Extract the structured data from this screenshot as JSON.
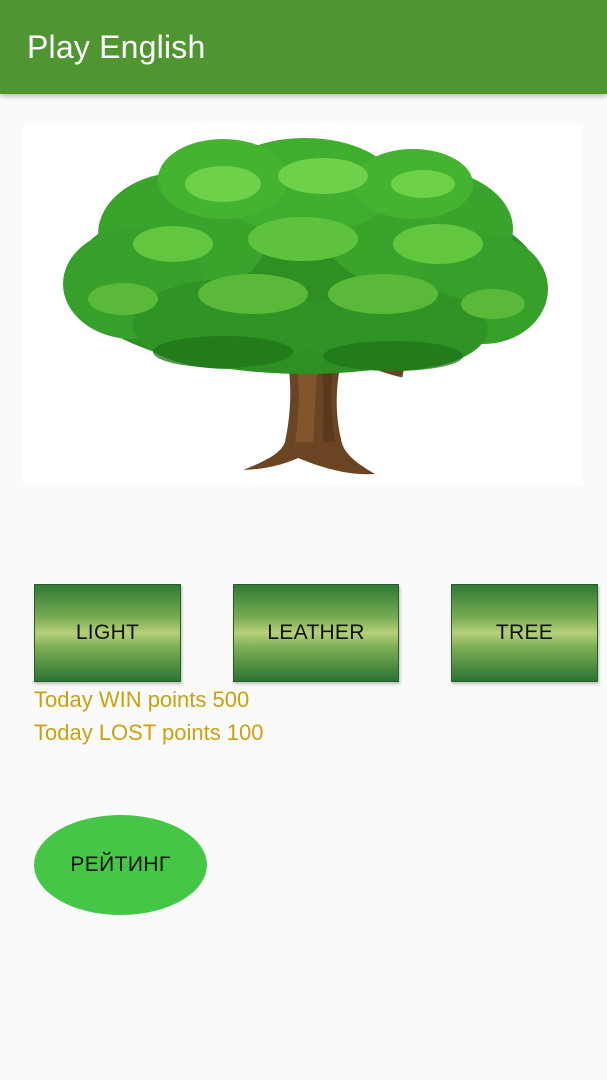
{
  "app_bar": {
    "title": "Play English"
  },
  "question": {
    "image_subject": "tree",
    "image_icon": "tree-illustration"
  },
  "answers": [
    {
      "label": "LIGHT"
    },
    {
      "label": "LEATHER"
    },
    {
      "label": "TREE"
    }
  ],
  "score": {
    "win_text": "Today WIN points 500",
    "lost_text": "Today LOST points 100"
  },
  "rating_button": {
    "label": "РЕЙТИНГ"
  },
  "colors": {
    "app_bar": "#4f9632",
    "score_text": "#c9a20e",
    "rating_button": "#46c646"
  }
}
